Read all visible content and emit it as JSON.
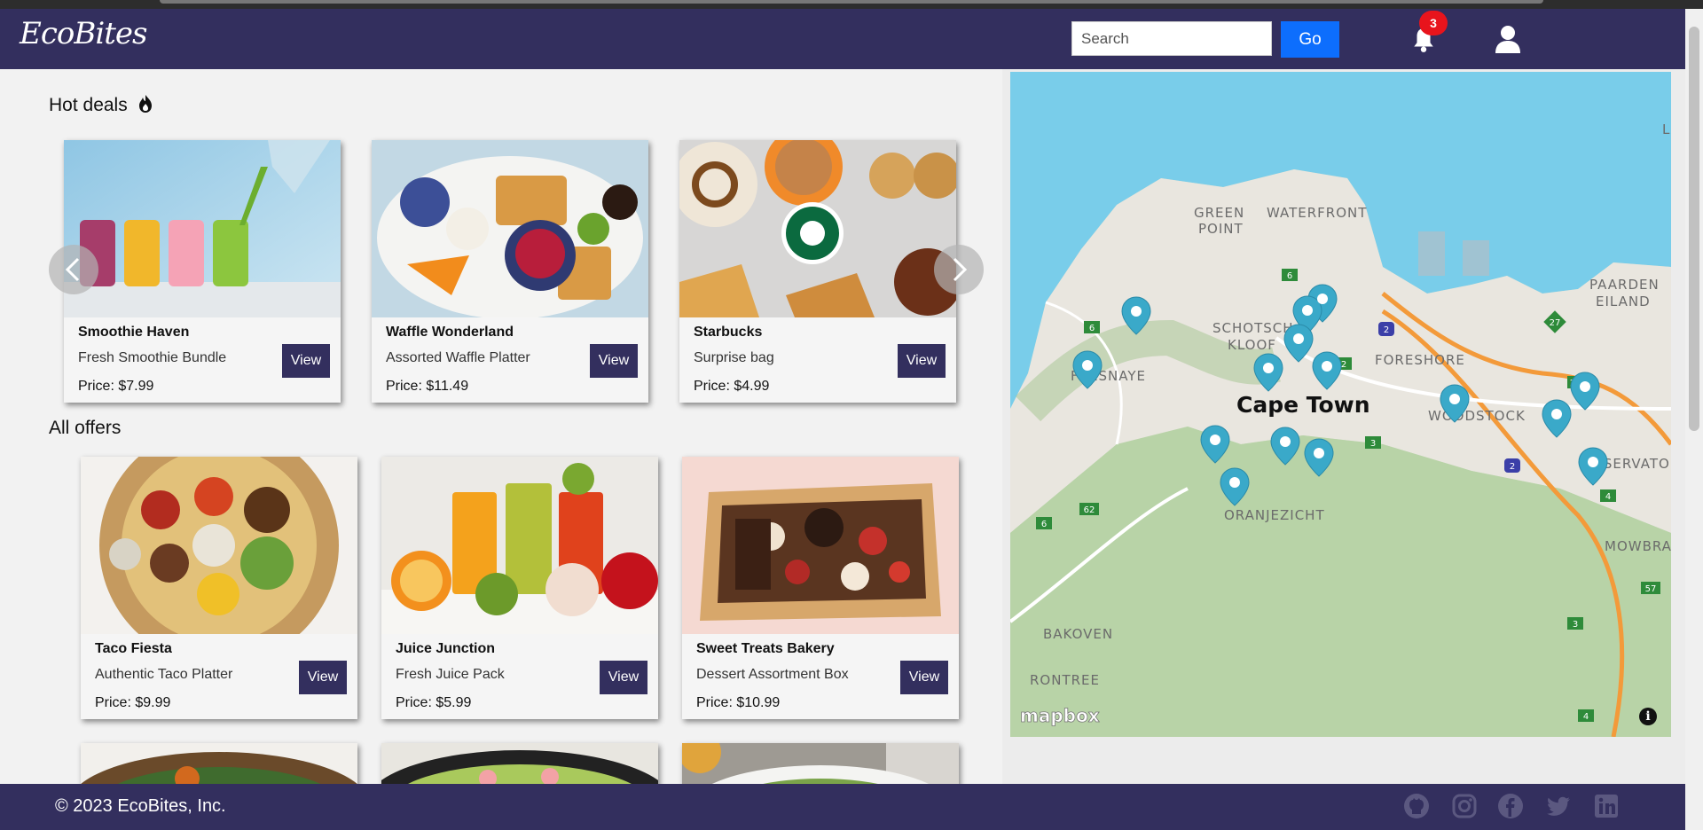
{
  "app": {
    "logo": "EcoBites"
  },
  "header": {
    "search_placeholder": "Search",
    "go_label": "Go",
    "notification_count": "3"
  },
  "hot_deals": {
    "title": "Hot deals",
    "items": [
      {
        "name": "Smoothie Haven",
        "desc": "Fresh Smoothie Bundle",
        "price": "Price: $7.99",
        "view": "View"
      },
      {
        "name": "Waffle Wonderland",
        "desc": "Assorted Waffle Platter",
        "price": "Price: $11.49",
        "view": "View"
      },
      {
        "name": "Starbucks",
        "desc": "Surprise bag",
        "price": "Price: $4.99",
        "view": "View"
      }
    ]
  },
  "all_offers": {
    "title": "All offers",
    "items": [
      {
        "name": "Taco Fiesta",
        "desc": "Authentic Taco Platter",
        "price": "Price: $9.99",
        "view": "View"
      },
      {
        "name": "Juice Junction",
        "desc": "Fresh Juice Pack",
        "price": "Price: $5.99",
        "view": "View"
      },
      {
        "name": "Sweet Treats Bakery",
        "desc": "Dessert Assortment Box",
        "price": "Price: $10.99",
        "view": "View"
      }
    ]
  },
  "map": {
    "labels": {
      "green_point_1": "GREEN",
      "green_point_2": "POINT",
      "waterfront": "WATERFRONT",
      "schotsche_1": "SCHOTSCH",
      "schotsche_2": "KLOOF",
      "foreshore": "FORESHORE",
      "paarden_1": "PAARDEN",
      "paarden_2": "EILAND",
      "fresnaye": "FRESNAYE",
      "city": "Cape Town",
      "woodstock": "WOODSTOCK",
      "observatory": "OBSERVATORY",
      "oranjezicht": "ORANJEZICHT",
      "mowbray": "MOWBRA",
      "bakoven": "BAKOVEN",
      "rontree": "RONTREE",
      "edge_l": "L"
    },
    "road_shields": [
      "6",
      "6",
      "2",
      "27",
      "102",
      "2",
      "3",
      "62",
      "6",
      "57",
      "3",
      "4",
      "4",
      "2"
    ],
    "attribution": "mapbox",
    "info": "i"
  },
  "footer": {
    "copyright": "© 2023 EcoBites, Inc."
  },
  "colors": {
    "brand": "#332f5e",
    "accent": "#0d6efd",
    "badge": "#e8141c",
    "pin": "#3aa9c9"
  },
  "icons": [
    "bell-icon",
    "user-icon",
    "flame-icon",
    "chevron-left-icon",
    "chevron-right-icon",
    "github-icon",
    "instagram-icon",
    "facebook-icon",
    "twitter-icon",
    "linkedin-icon",
    "map-pin-icon",
    "info-icon"
  ]
}
